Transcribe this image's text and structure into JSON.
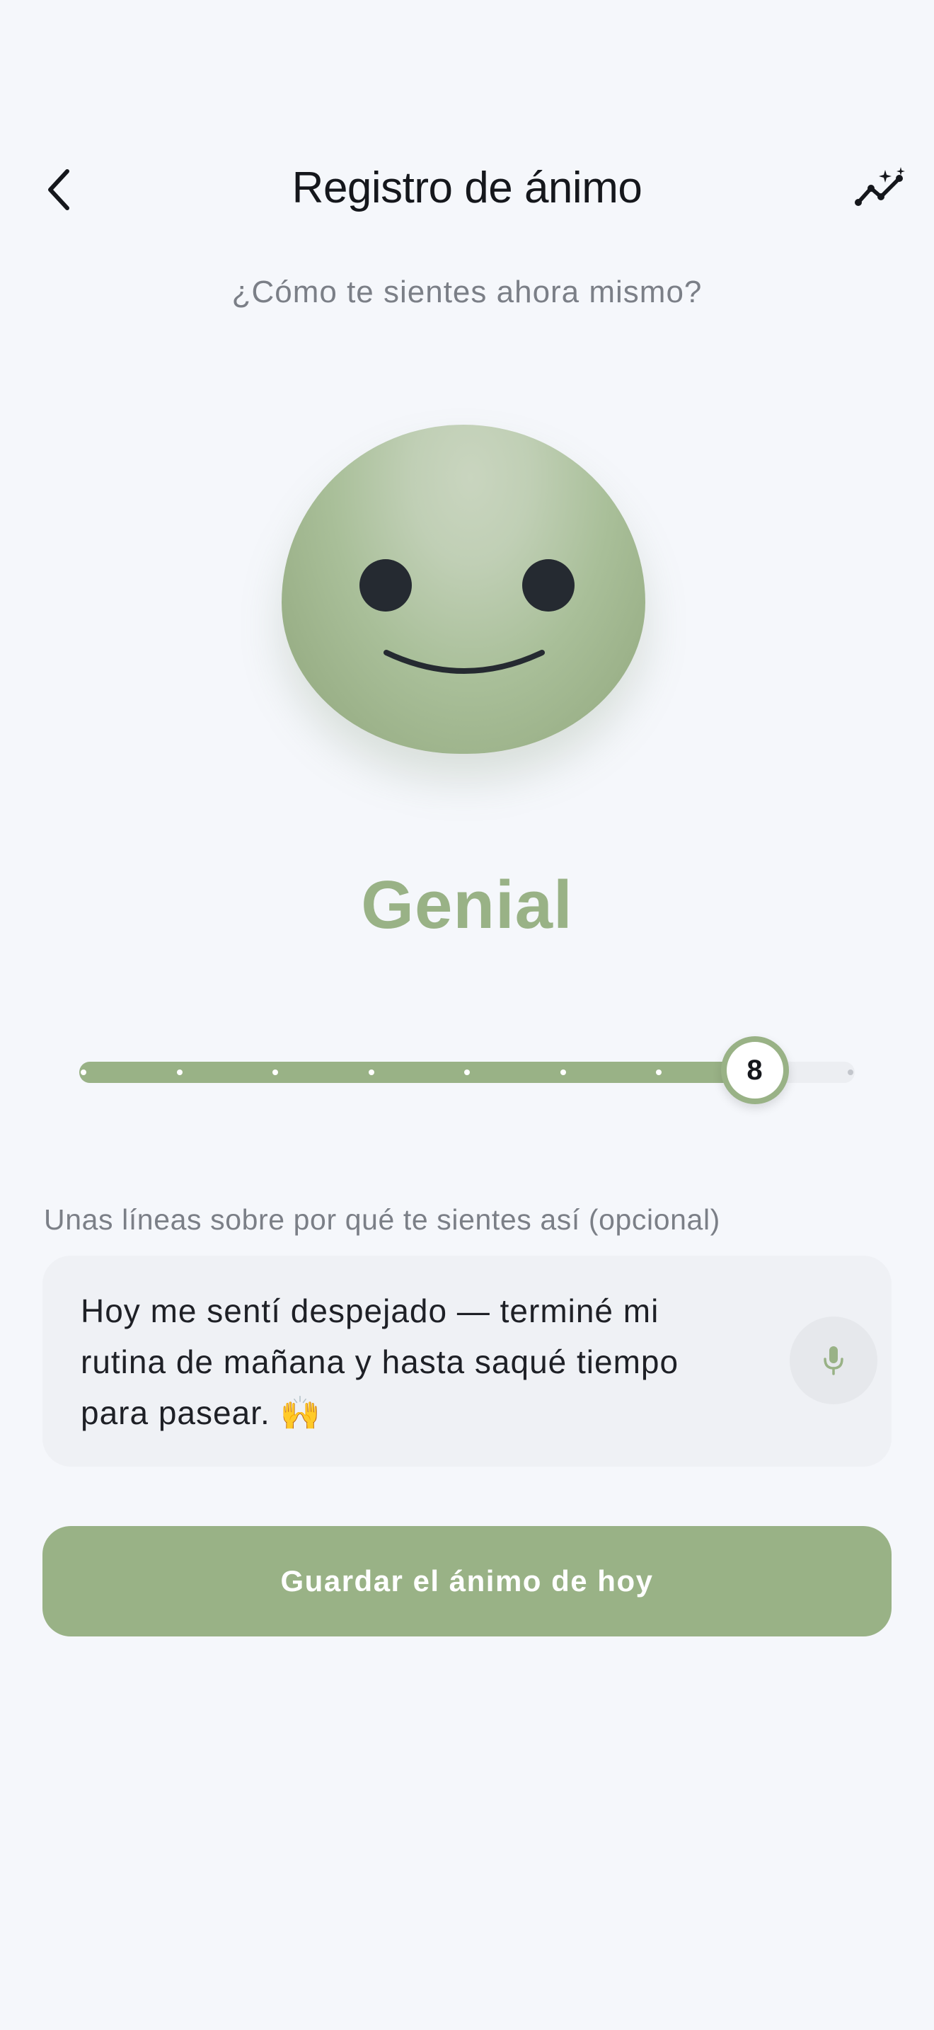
{
  "header": {
    "title": "Registro de ánimo",
    "back_icon": "chevron-left-icon",
    "insights_icon": "sparkle-trend-icon"
  },
  "prompt": "¿Cómo te sientes ahora mismo?",
  "mood": {
    "label": "Genial",
    "face_icon": "smiling-face-icon",
    "color": "#99b286"
  },
  "slider": {
    "value": 8,
    "value_label": "8",
    "min": 1,
    "max": 9
  },
  "notes": {
    "label": "Unas líneas sobre por qué te sientes así (opcional)",
    "value": "Hoy me sentí despejado — terminé mi\nrutina de mañana y hasta saqué tiempo\npara pasear. 🙌",
    "mic_icon": "microphone-icon"
  },
  "save_button": {
    "label": "Guardar el ánimo de hoy"
  },
  "colors": {
    "accent": "#99b286",
    "background": "#f5f7fb",
    "text_muted": "#7b7f87"
  }
}
